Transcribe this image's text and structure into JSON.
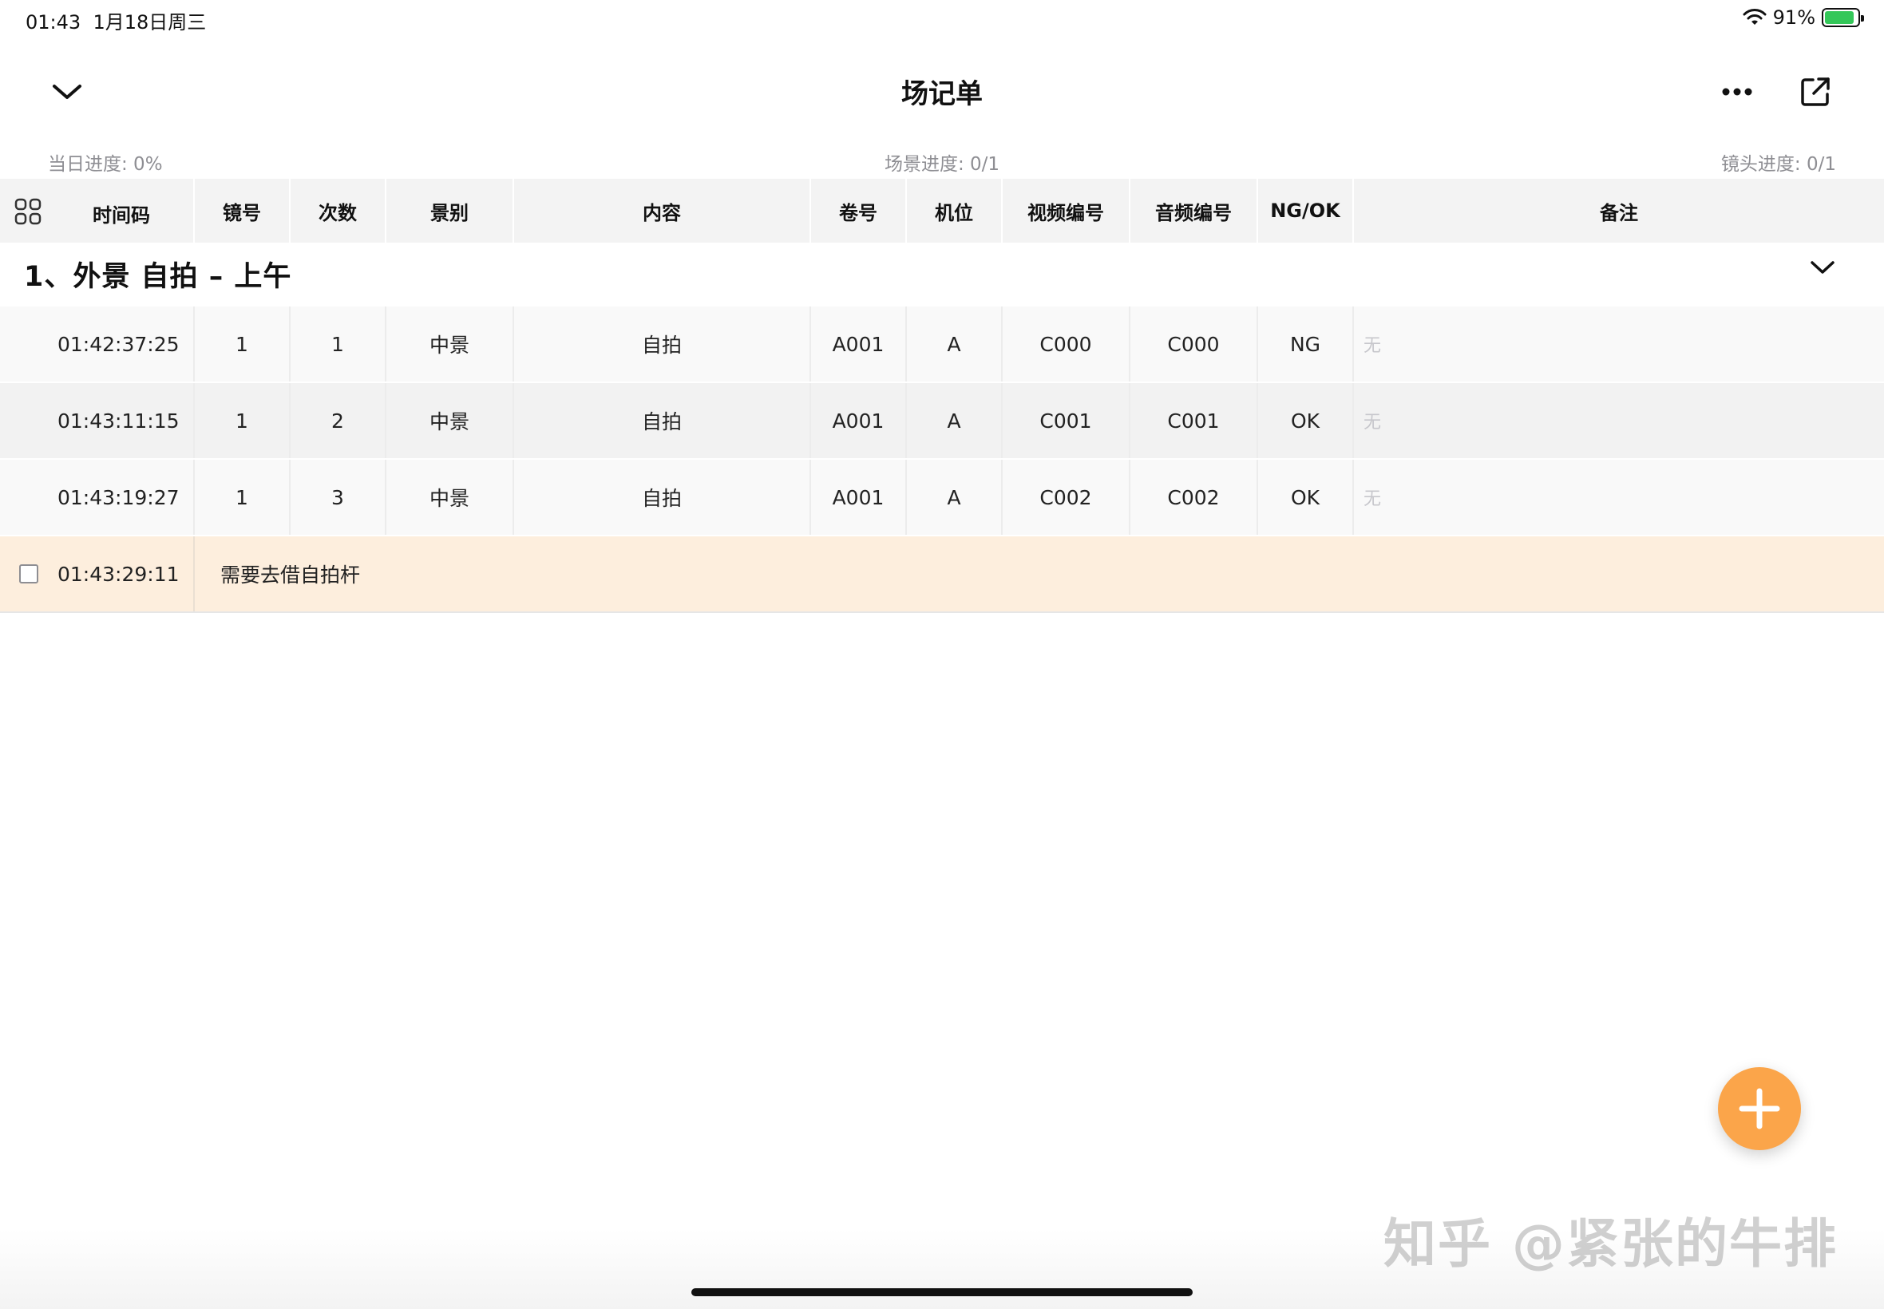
{
  "status_bar": {
    "time": "01:43",
    "date": "1月18日周三",
    "battery_percent": "91%",
    "battery_level": 0.91
  },
  "header": {
    "title": "场记单",
    "collapse_icon": "chevron-down-icon",
    "more_icon": "ellipsis-icon",
    "share_icon": "share-export-icon"
  },
  "progress": {
    "day": "当日进度: 0%",
    "scene": "场景进度: 0/1",
    "shot": "镜头进度: 0/1"
  },
  "table": {
    "columns": [
      "时间码",
      "镜号",
      "次数",
      "景别",
      "内容",
      "卷号",
      "机位",
      "视频编号",
      "音频编号",
      "NG/OK",
      "备注"
    ],
    "scene_title": "1、外景 自拍 – 上午",
    "rows": [
      [
        "01:42:37:25",
        "1",
        "1",
        "中景",
        "自拍",
        "A001",
        "A",
        "C000",
        "C000",
        "NG",
        "无"
      ],
      [
        "01:43:11:15",
        "1",
        "2",
        "中景",
        "自拍",
        "A001",
        "A",
        "C001",
        "C001",
        "OK",
        "无"
      ],
      [
        "01:43:19:27",
        "1",
        "3",
        "中景",
        "自拍",
        "A001",
        "A",
        "C002",
        "C002",
        "OK",
        "无"
      ]
    ],
    "memo": {
      "time": "01:43:29:11",
      "text": "需要去借自拍杆",
      "checked": false
    }
  },
  "fab": {
    "icon": "plus-icon"
  },
  "watermark": "知乎 @紧张的牛排",
  "colors": {
    "accent": "#fba54a",
    "memo_bg": "#fdeedd",
    "header_bg": "#f3f3f3"
  }
}
